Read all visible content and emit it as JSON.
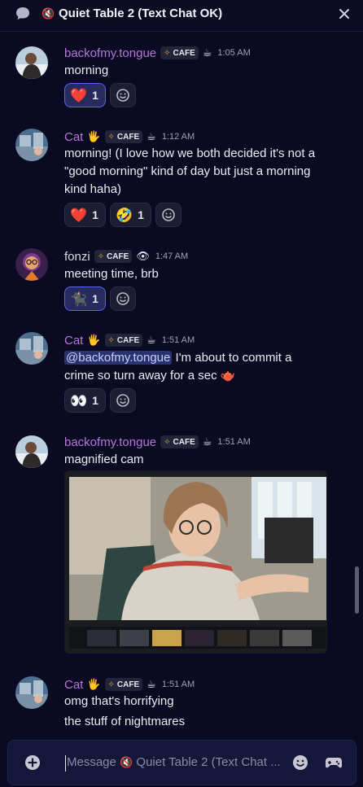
{
  "window": {
    "channel_emoji": "🔇",
    "title": "Quiet Table 2 (Text Chat OK)"
  },
  "messages": [
    {
      "author": "backofmy.tongue",
      "tag": "CAFE",
      "status_emoji": "☕",
      "time": "1:05 AM",
      "lines": [
        "morning"
      ],
      "reactions": [
        {
          "emoji": "❤️",
          "count": "1",
          "mine": true
        }
      ]
    },
    {
      "author": "Cat",
      "author_emoji": "🖐",
      "tag": "CAFE",
      "status_emoji": "☕",
      "time": "1:12 AM",
      "lines": [
        "morning! (I love how we both decided it's not a",
        "\"good morning\" kind of day but just a morning",
        "kind haha)"
      ],
      "reactions": [
        {
          "emoji": "❤️",
          "count": "1"
        },
        {
          "emoji": "🤣",
          "count": "1"
        }
      ]
    },
    {
      "author": "fonzi",
      "tag": "CAFE",
      "status_emoji": "👁",
      "time": "1:47 AM",
      "lines": [
        "meeting time, brb"
      ],
      "reactions": [
        {
          "emoji": "🐈‍⬛",
          "count": "1",
          "mine": true
        }
      ]
    },
    {
      "author": "Cat",
      "author_emoji": "🖐",
      "tag": "CAFE",
      "status_emoji": "☕",
      "time": "1:51 AM",
      "mention": "@backofmy.tongue",
      "lines": [
        " I'm about to commit a",
        "crime so turn away for a sec"
      ],
      "line_emoji": "🫖",
      "reactions": [
        {
          "emoji": "👀",
          "count": "1"
        }
      ]
    },
    {
      "author": "backofmy.tongue",
      "tag": "CAFE",
      "status_emoji": "☕",
      "time": "1:51 AM",
      "lines": [
        "magnified cam"
      ]
    },
    {
      "author": "Cat",
      "author_emoji": "🖐",
      "tag": "CAFE",
      "status_emoji": "☕",
      "time": "1:51 AM",
      "lines": [
        "omg that's horrifying",
        "the stuff of nightmares"
      ]
    }
  ],
  "composer": {
    "placeholder_prefix": "Message ",
    "placeholder_emoji": "🔇",
    "placeholder_rest": " Quiet Table 2 (Text Chat ..."
  },
  "icons": {
    "top_left": "chat-bubble-icon",
    "top_right": "close-icon",
    "add": "plus-circle-icon",
    "add_reaction": "add-reaction-icon",
    "emoji_picker": "smile-icon",
    "activities": "gamepad-icon"
  },
  "colors": {
    "author": "#b479d6",
    "mention_bg": "#2b3270",
    "reaction_selected_border": "#5865f2"
  }
}
